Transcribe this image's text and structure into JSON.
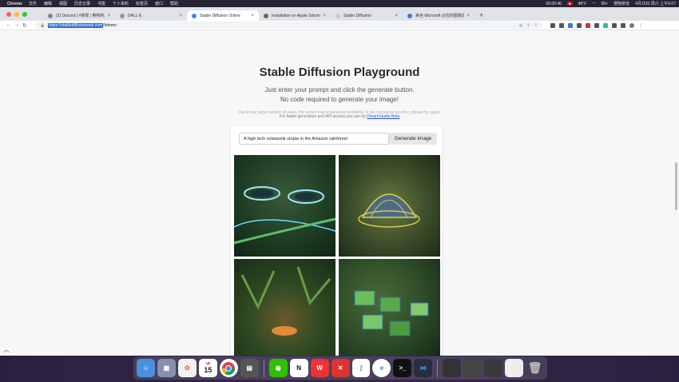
{
  "menubar": {
    "app": "Chrome",
    "items": [
      "文件",
      "编辑",
      "视图",
      "历史记录",
      "书签",
      "个人资料",
      "标签页",
      "窗口",
      "帮助"
    ],
    "time": "00:00:46",
    "battery": "48°F",
    "counter": "99+",
    "input_method": "搜狗拼音",
    "date": "4月15日 周六 上午6:07"
  },
  "tabs": [
    {
      "title": "(3) Discord | #常规 | 奥特的服务..."
    },
    {
      "title": "DALL·E"
    },
    {
      "title": "Stable Diffusion Online"
    },
    {
      "title": "Installation on Apple Silicon · A..."
    },
    {
      "title": "Stable Diffusion"
    },
    {
      "title": "来自 Microsoft 必应的图像创建..."
    }
  ],
  "address": {
    "selected": "https://stablediffusionweb.com",
    "rest": "/#demo"
  },
  "page": {
    "title": "Stable Diffusion Playground",
    "subtitle1": "Just enter your prompt and click the generate button.",
    "subtitle2": "No code required to generate your image!",
    "notice": "Due to the large number of users, the server may experience problems. If you encounter an error, please try again.",
    "notice2_prefix": "For faster generation and API access you can try",
    "notice2_link": "DreamStudio Beta"
  },
  "prompt": {
    "value": "A high tech solarpunk utopia in the Amazon rainforest"
  },
  "generate_button": "Generate image",
  "dock": {
    "calendar_month": "4月",
    "calendar_day": "15"
  }
}
